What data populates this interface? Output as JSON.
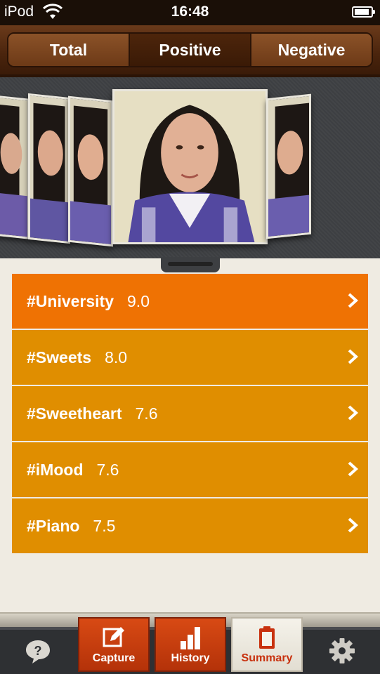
{
  "status_bar": {
    "carrier": "iPod",
    "time": "16:48"
  },
  "segments": [
    {
      "label": "Total",
      "active": false
    },
    {
      "label": "Positive",
      "active": true
    },
    {
      "label": "Negative",
      "active": false
    }
  ],
  "tags": [
    {
      "tag": "#University",
      "score": "9.0"
    },
    {
      "tag": "#Sweets",
      "score": "8.0"
    },
    {
      "tag": "#Sweetheart",
      "score": "7.6"
    },
    {
      "tag": "#iMood",
      "score": "7.6"
    },
    {
      "tag": "#Piano",
      "score": "7.5"
    }
  ],
  "tabs": [
    {
      "label": "Capture",
      "icon": "pencil-edit-icon"
    },
    {
      "label": "History",
      "icon": "bar-chart-icon"
    },
    {
      "label": "Summary",
      "icon": "clipboard-icon",
      "selected": true
    }
  ],
  "colors": {
    "top_row": "#ef7203",
    "row": "#e08e00",
    "selected_tab_text": "#c8310e"
  }
}
